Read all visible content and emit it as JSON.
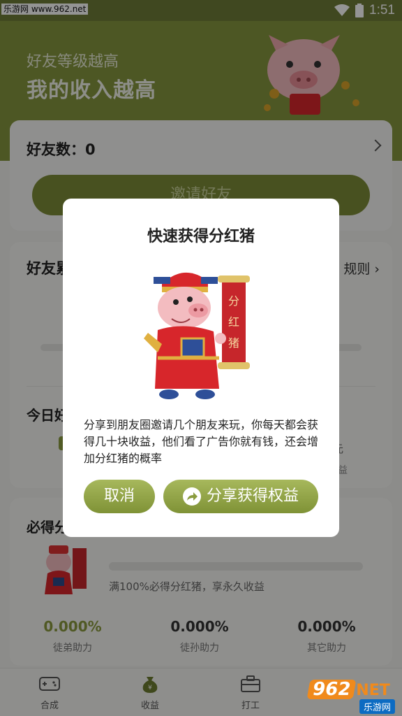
{
  "status_bar": {
    "watermark": "乐游网 www.962.net",
    "time": "1:51"
  },
  "hero": {
    "subtitle": "好友等级越高",
    "title": "我的收入越高"
  },
  "friends_card": {
    "count_label": "好友数：0",
    "invite_button": "邀请好友"
  },
  "reward_card": {
    "title_partial": "好友累",
    "rules_partial": "规则",
    "today_partial": "今日好",
    "right_text_1": "元",
    "right_text_2": "益"
  },
  "must_card": {
    "title_partial": "必得分",
    "description": "满100%必得分红猪，享永久收益",
    "stats": [
      {
        "value": "0.000%",
        "label": "徒弟助力"
      },
      {
        "value": "0.000%",
        "label": "徒孙助力"
      },
      {
        "value": "0.000%",
        "label": "其它助力"
      }
    ]
  },
  "tabbar": {
    "tabs": [
      {
        "label": "合成",
        "icon": "gamepad-icon"
      },
      {
        "label": "收益",
        "icon": "money-bag-icon"
      },
      {
        "label": "打工",
        "icon": "briefcase-icon"
      }
    ]
  },
  "corner_logo": {
    "number": "962",
    "suffix": "NET",
    "chinese": "乐游网"
  },
  "dialog": {
    "title": "快速获得分红猪",
    "body": "分享到朋友圈邀请几个朋友来玩，你每天都会获得几十块收益，他们看了广告你就有钱，还会增加分红猪的概率",
    "cancel_button": "取消",
    "share_button": "分享获得权益",
    "scroll_text": "分红猪"
  },
  "colors": {
    "brand_green": "#85963f",
    "button_green": "#8fa244"
  }
}
